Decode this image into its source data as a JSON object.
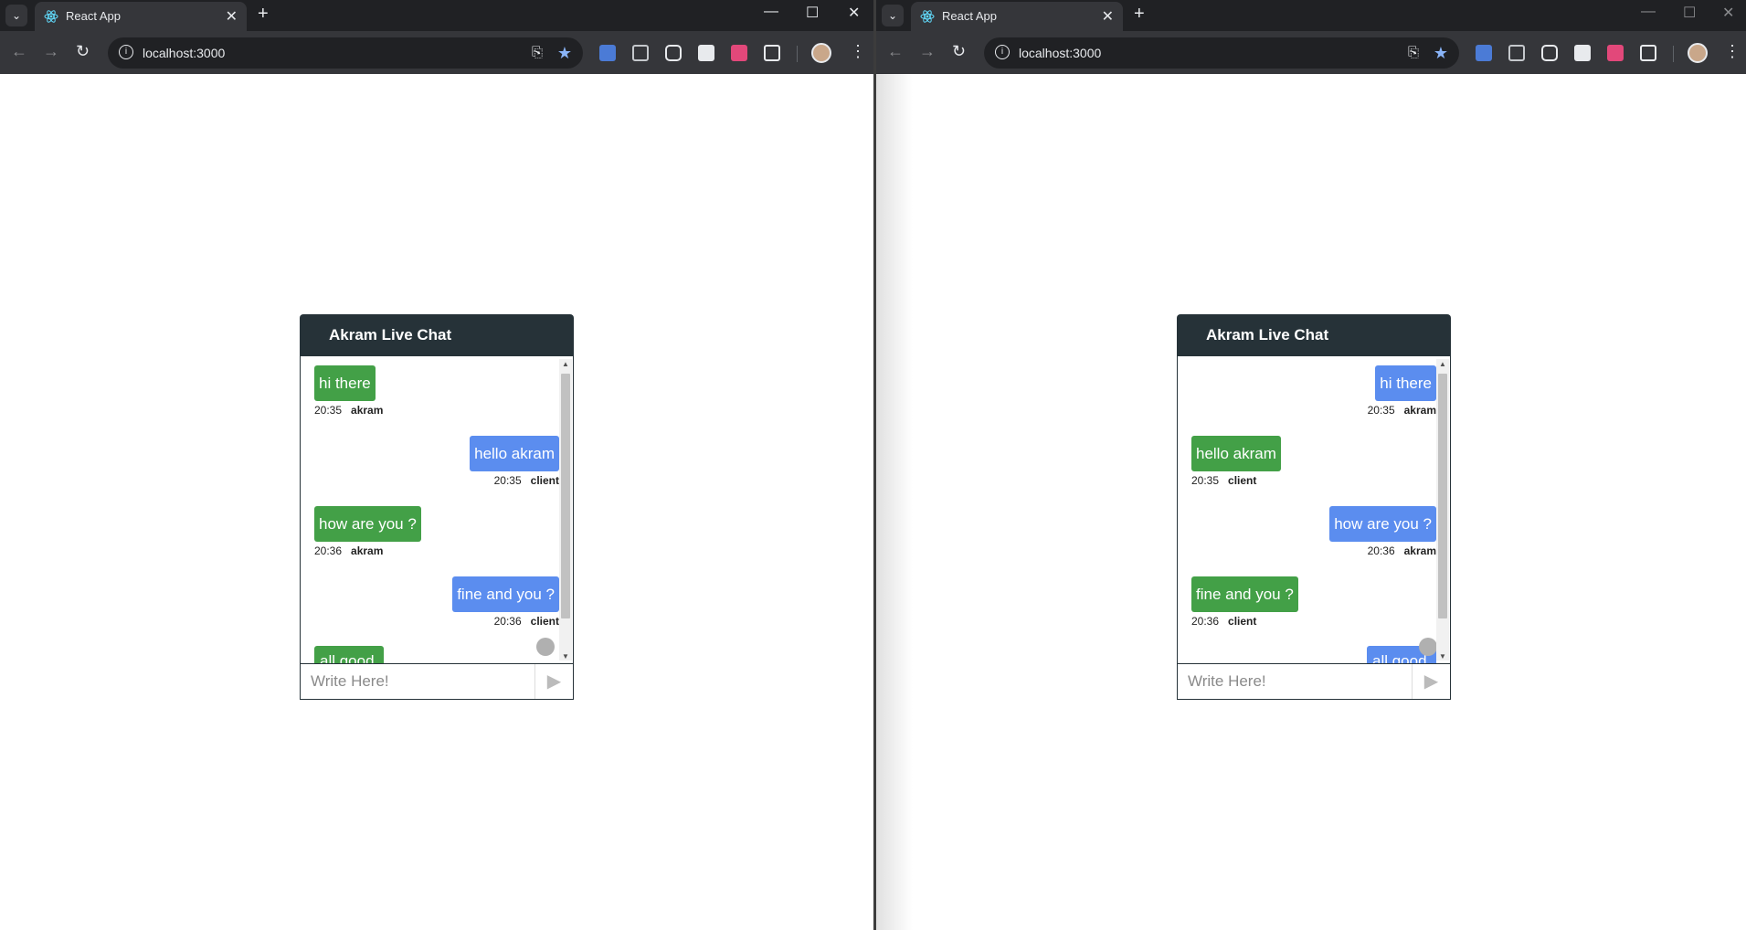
{
  "browser": {
    "tab_title": "React App",
    "url": "localhost:3000",
    "icons": {
      "tab_list": "chevron-down-icon",
      "favicon": "react-icon",
      "close_tab": "close-icon",
      "new_tab": "plus-icon",
      "minimize": "minimize-icon",
      "maximize": "maximize-icon",
      "close_window": "close-icon",
      "back": "back-arrow-icon",
      "forward": "forward-arrow-icon",
      "reload": "reload-icon",
      "site_info": "info-icon",
      "install": "install-app-icon",
      "bookmark": "star-icon",
      "extensions": "puzzle-icon",
      "menu": "kebab-menu-icon"
    },
    "glyphs": {
      "tab_list": "⌄",
      "close_tab": "✕",
      "new_tab": "+",
      "minimize": "—",
      "maximize": "☐",
      "close_window": "✕",
      "back": "←",
      "forward": "→",
      "reload": "↻",
      "info": "i",
      "install": "⎘",
      "star": "★",
      "menu": "⋮"
    }
  },
  "chat": {
    "header_title": "Akram Live Chat",
    "input_placeholder": "Write Here!",
    "send_glyph": "▶"
  },
  "windows": [
    {
      "view": "left",
      "messages": [
        {
          "text": "hi there",
          "time": "20:35",
          "sender": "akram",
          "color": "#43a047",
          "side": "left"
        },
        {
          "text": "hello akram",
          "time": "20:35",
          "sender": "client",
          "color": "#5b8def",
          "side": "right"
        },
        {
          "text": "how are you ?",
          "time": "20:36",
          "sender": "akram",
          "color": "#43a047",
          "side": "left"
        },
        {
          "text": "fine and you ?",
          "time": "20:36",
          "sender": "client",
          "color": "#5b8def",
          "side": "right"
        }
      ],
      "partial_message": {
        "text": "all good",
        "color": "#43a047",
        "side": "left"
      }
    },
    {
      "view": "right",
      "messages": [
        {
          "text": "hi there",
          "time": "20:35",
          "sender": "akram",
          "color": "#5b8def",
          "side": "right"
        },
        {
          "text": "hello akram",
          "time": "20:35",
          "sender": "client",
          "color": "#43a047",
          "side": "left"
        },
        {
          "text": "how are you ?",
          "time": "20:36",
          "sender": "akram",
          "color": "#5b8def",
          "side": "right"
        },
        {
          "text": "fine and you ?",
          "time": "20:36",
          "sender": "client",
          "color": "#43a047",
          "side": "left"
        }
      ],
      "partial_message": {
        "text": "all good",
        "color": "#5b8def",
        "side": "right"
      }
    }
  ]
}
